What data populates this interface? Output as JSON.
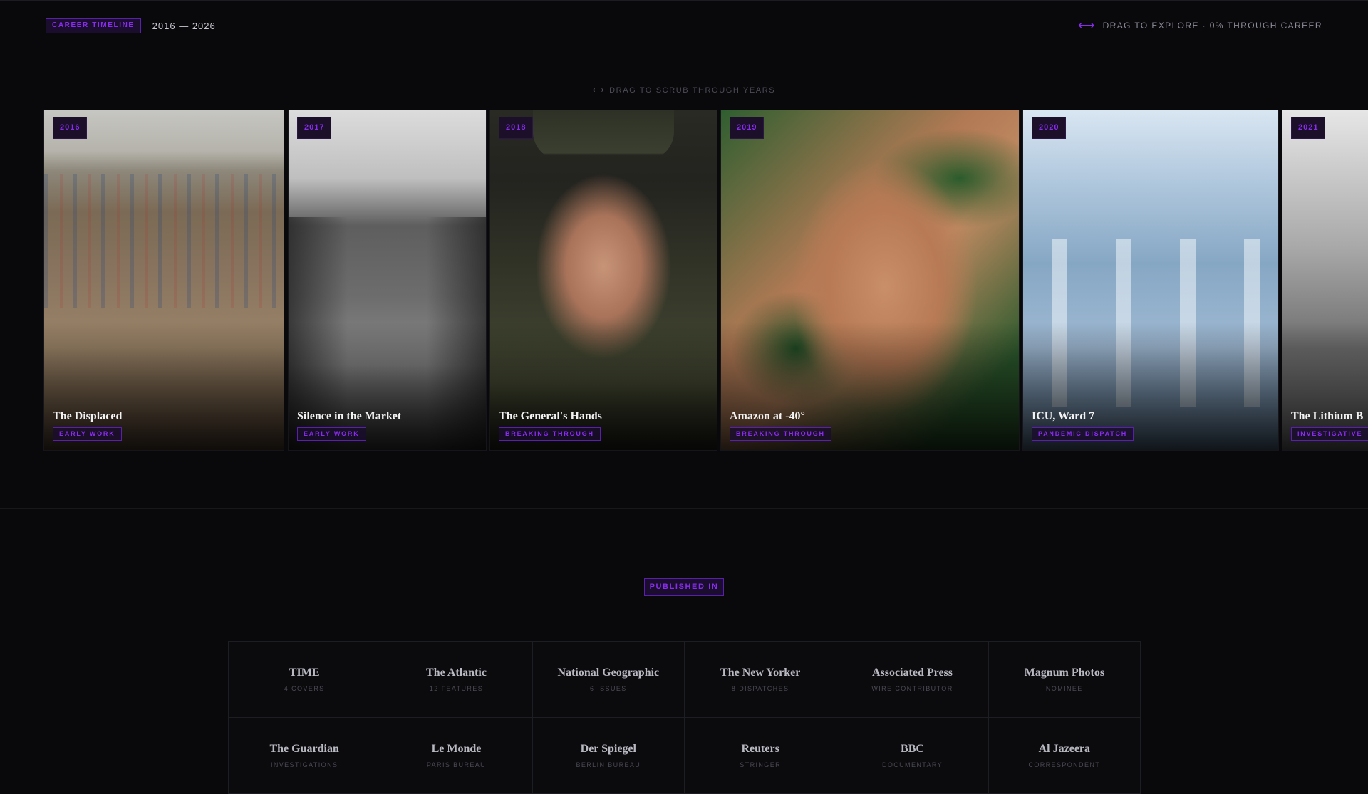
{
  "header": {
    "badge": "CAREER TIMELINE",
    "years": "2016 — 2026",
    "hint_icon": "left-right-arrow-icon",
    "hint": "DRAG TO EXPLORE · 0% THROUGH CAREER"
  },
  "scrub_hint": "DRAG TO SCRUB THROUGH YEARS",
  "cards": [
    {
      "year": "2016",
      "title": "The Displaced",
      "tag": "EARLY WORK"
    },
    {
      "year": "2017",
      "title": "Silence in the Market",
      "tag": "EARLY WORK"
    },
    {
      "year": "2018",
      "title": "The General's Hands",
      "tag": "BREAKING THROUGH"
    },
    {
      "year": "2019",
      "title": "Amazon at -40°",
      "tag": "BREAKING THROUGH"
    },
    {
      "year": "2020",
      "title": "ICU, Ward 7",
      "tag": "PANDEMIC DISPATCH"
    },
    {
      "year": "2021",
      "title": "The Lithium B",
      "tag": "INVESTIGATIVE"
    }
  ],
  "published": {
    "title": "PUBLISHED IN",
    "outlets": [
      {
        "name": "TIME",
        "detail": "4 COVERS"
      },
      {
        "name": "The Atlantic",
        "detail": "12 FEATURES"
      },
      {
        "name": "National Geographic",
        "detail": "6 ISSUES"
      },
      {
        "name": "The New Yorker",
        "detail": "8 DISPATCHES"
      },
      {
        "name": "Associated Press",
        "detail": "WIRE CONTRIBUTOR"
      },
      {
        "name": "Magnum Photos",
        "detail": "NOMINEE"
      },
      {
        "name": "The Guardian",
        "detail": "INVESTIGATIONS"
      },
      {
        "name": "Le Monde",
        "detail": "PARIS BUREAU"
      },
      {
        "name": "Der Spiegel",
        "detail": "BERLIN BUREAU"
      },
      {
        "name": "Reuters",
        "detail": "STRINGER"
      },
      {
        "name": "BBC",
        "detail": "DOCUMENTARY"
      },
      {
        "name": "Al Jazeera",
        "detail": "CORRESPONDENT"
      }
    ]
  },
  "colors": {
    "accent": "#8a2cf0",
    "background": "#09090c"
  }
}
